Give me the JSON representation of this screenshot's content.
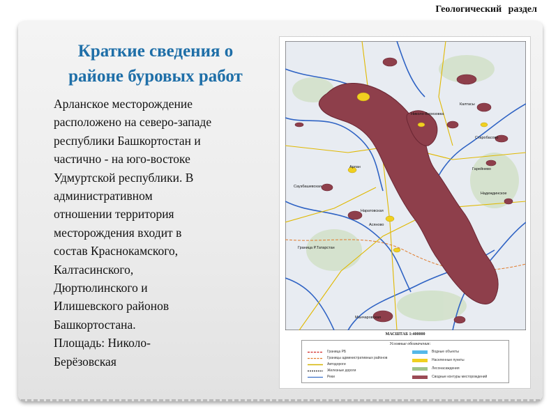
{
  "header": {
    "section_label": "Геологический   раздел"
  },
  "slide": {
    "title_lines": [
      "Краткие сведения о",
      "районе буровых работ"
    ],
    "body_lines": [
      "Арланское месторождение",
      "расположено на северо-западе",
      "республики Башкортостан и",
      "частично - на юго-востоке",
      "Удмуртской республики. В",
      "административном",
      "отношении территория",
      "месторождения входит в",
      "состав Краснокамского,",
      "Калтасинского,",
      "Дюртюлинского и",
      "Илишевского районов",
      "Башкортостана.",
      "Площадь: Николо-",
      "Берёзовская"
    ]
  },
  "map": {
    "scale_label": "МАСШТАБ 1:400000",
    "place_labels": [
      "Арлан",
      "Николо-Березовка",
      "Калтасы",
      "Старобасово",
      "Гарейнево",
      "Надеждинское",
      "Саузбашевская",
      "Асяново",
      "Наратовская",
      "Граница Р.Татарстан",
      "Манчаровская"
    ],
    "legend": {
      "title": "Условные обозначения:",
      "items": [
        {
          "label": "Граница РБ",
          "color": "#d02020",
          "style": "dash"
        },
        {
          "label": "Границы административных районов",
          "color": "#e07a2a",
          "style": "dash"
        },
        {
          "label": "Автодороги",
          "color": "#d4b400",
          "style": "line"
        },
        {
          "label": "Железные дороги",
          "color": "#444444",
          "style": "rail"
        },
        {
          "label": "Реки",
          "color": "#3a70c8",
          "style": "line"
        },
        {
          "label": "Водные объекты",
          "color": "#55b8e8",
          "style": "box"
        },
        {
          "label": "Населенные пункты",
          "color": "#f0d020",
          "style": "box"
        },
        {
          "label": "Лесонасаждения",
          "color": "#9ec38a",
          "style": "box"
        },
        {
          "label": "Сводные контуры месторождений",
          "color": "#9b4a55",
          "style": "box"
        }
      ]
    },
    "colors": {
      "field": "#8e3f4b",
      "field_border": "#6a2633",
      "river": "#2f63c4",
      "road": "#e0b800",
      "terrain": "#e8ecf2"
    }
  }
}
